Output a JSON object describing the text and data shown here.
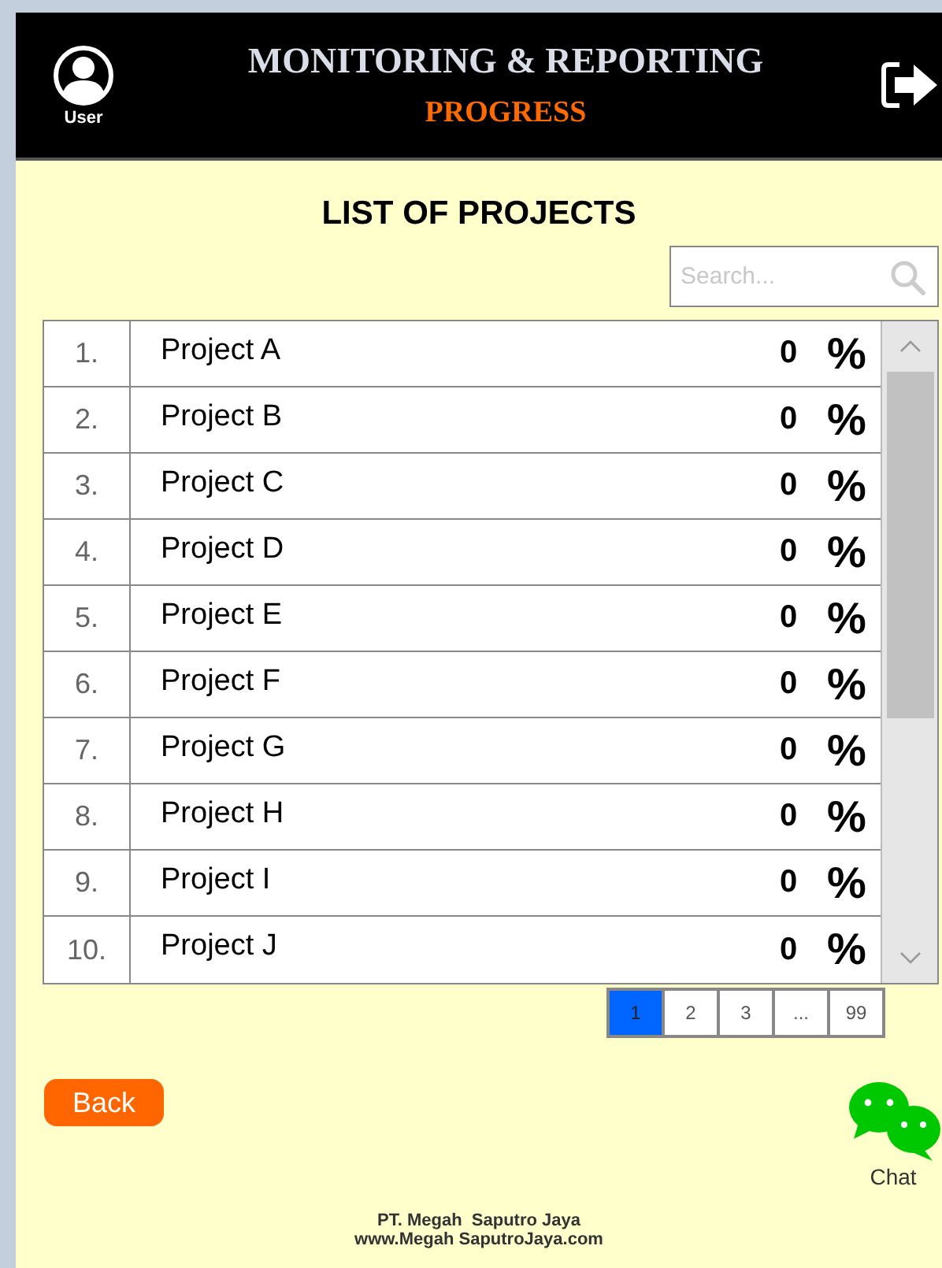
{
  "header": {
    "user_label": "User",
    "title": "MONITORING & REPORTING",
    "subtitle": "PROGRESS"
  },
  "page_title": "LIST OF PROJECTS",
  "search": {
    "placeholder": "Search..."
  },
  "projects": [
    {
      "number": "1.",
      "name": "Project A",
      "value": "0",
      "unit": "%"
    },
    {
      "number": "2.",
      "name": "Project B",
      "value": "0",
      "unit": "%"
    },
    {
      "number": "3.",
      "name": "Project C",
      "value": "0",
      "unit": "%"
    },
    {
      "number": "4.",
      "name": "Project D",
      "value": "0",
      "unit": "%"
    },
    {
      "number": "5.",
      "name": "Project E",
      "value": "0",
      "unit": "%"
    },
    {
      "number": "6.",
      "name": "Project F",
      "value": "0",
      "unit": "%"
    },
    {
      "number": "7.",
      "name": "Project G",
      "value": "0",
      "unit": "%"
    },
    {
      "number": "8.",
      "name": "Project H",
      "value": "0",
      "unit": "%"
    },
    {
      "number": "9.",
      "name": "Project I",
      "value": "0",
      "unit": "%"
    },
    {
      "number": "10.",
      "name": "Project J",
      "value": "0",
      "unit": "%"
    }
  ],
  "pagination": [
    {
      "label": "1",
      "selected": true
    },
    {
      "label": "2",
      "selected": false
    },
    {
      "label": "3",
      "selected": false
    },
    {
      "label": "...",
      "selected": false
    },
    {
      "label": "99",
      "selected": false
    }
  ],
  "back_button": "Back",
  "chat_label": "Chat",
  "footer": {
    "company": "PT. Megah  Saputro Jaya",
    "website": "www.Megah SaputroJaya.com"
  }
}
